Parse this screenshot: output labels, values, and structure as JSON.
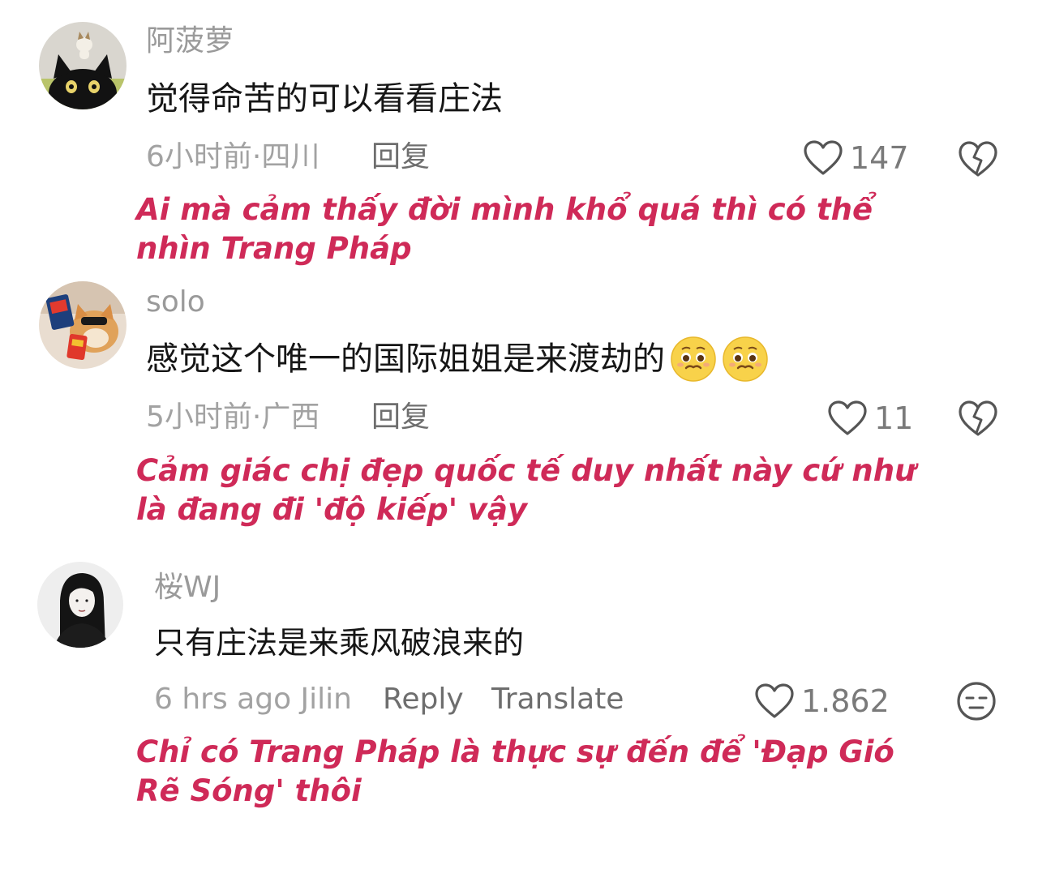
{
  "colors": {
    "translation_text": "#cf2a58",
    "username": "#9a9a9a",
    "body_text": "#161616",
    "meta": "#a2a2a2",
    "action": "#6e6e6e"
  },
  "comments": [
    {
      "username": "阿菠萝",
      "avatar": "cat-avatar",
      "text": "觉得命苦的可以看看庄法",
      "meta": "6小时前·四川",
      "reply_label": "回复",
      "likes": "147",
      "right_icon": "heart-broken-icon",
      "translation": "Ai mà cảm thấy đời mình khổ quá thì có thể nhìn Trang Pháp"
    },
    {
      "username": "solo",
      "avatar": "dog-avatar",
      "text": "感觉这个唯一的国际姐姐是来渡劫的",
      "emojis": [
        "pleading-face-emoji",
        "pleading-face-emoji"
      ],
      "meta": "5小时前·广西",
      "reply_label": "回复",
      "likes": "11",
      "right_icon": "heart-broken-icon",
      "translation": "Cảm giác chị đẹp quốc tế duy nhất này cứ như là đang đi 'độ kiếp' vậy"
    },
    {
      "username": "桜WJ",
      "avatar": "girl-avatar",
      "text": "只有庄法是来乘风破浪来的",
      "meta": "6 hrs ago Jilin",
      "reply_label": "Reply",
      "translate_label": "Translate",
      "likes": "1.862",
      "right_icon": "expressionless-face-icon",
      "translation": "Chỉ có Trang Pháp là thực sự đến để 'Đạp Gió Rẽ Sóng' thôi"
    }
  ]
}
